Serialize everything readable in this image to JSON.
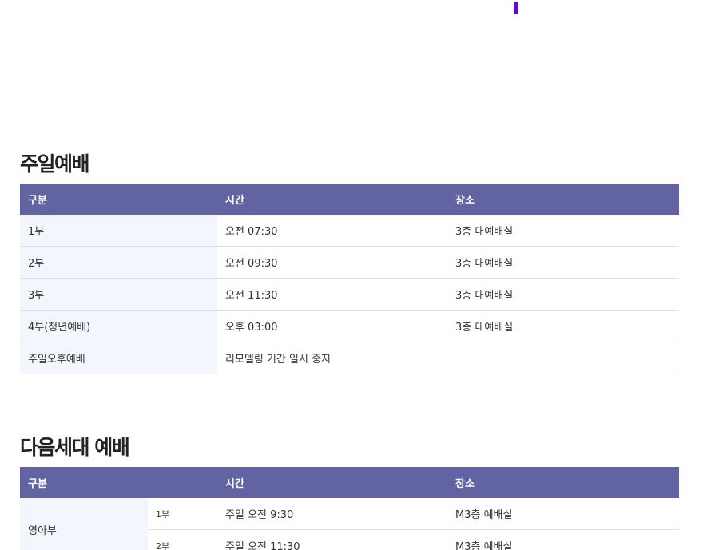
{
  "sunday_worship": {
    "title": "주일예배",
    "headers": [
      "구분",
      "시간",
      "장소"
    ],
    "rows": [
      {
        "category": "1부",
        "time": "오전 07:30",
        "place": "3층 대예배실"
      },
      {
        "category": "2부",
        "time": "오전 09:30",
        "place": "3층 대예배실"
      },
      {
        "category": "3부",
        "time": "오전 11:30",
        "place": "3층 대예배실"
      },
      {
        "category": "4부(청년예배)",
        "time": "오후 03:00",
        "place": "3층 대예배실"
      },
      {
        "category": "주일오후예배",
        "time": "리모델링 기간 일시 중지",
        "place": ""
      }
    ]
  },
  "next_generation": {
    "title": "다음세대 예배",
    "headers": [
      "구분",
      "시간",
      "장소"
    ],
    "rows": [
      {
        "category": "영아부",
        "sub": "1부",
        "time": "주일 오전 9:30",
        "place": "M3층 예배실"
      },
      {
        "category": "",
        "sub": "2부",
        "time": "주일 오전 11:30",
        "place": "M3층 예배실"
      }
    ]
  },
  "colors": {
    "header_bg": "#6263a1",
    "category_bg": "#f3f6fc",
    "accent_mark": "#6b00d6"
  }
}
